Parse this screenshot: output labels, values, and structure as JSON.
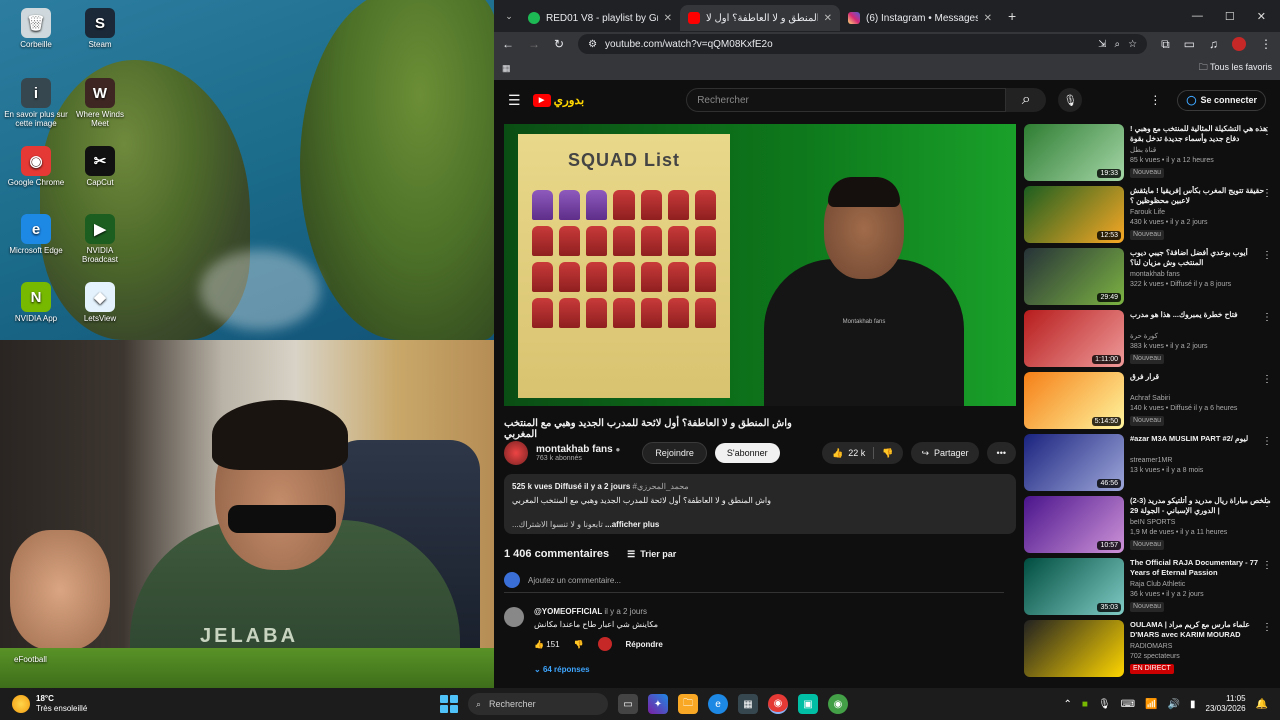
{
  "desktop": {
    "icons": [
      {
        "label": "Corbeille",
        "glyph": "🗑",
        "color": "#cfd8dc"
      },
      {
        "label": "Steam",
        "glyph": "S",
        "color": "#1b2838"
      },
      {
        "label": "En savoir plus sur cette image",
        "glyph": "i",
        "color": "#37474f"
      },
      {
        "label": "Where Winds Meet",
        "glyph": "W",
        "color": "#3e2723"
      },
      {
        "label": "Google Chrome",
        "glyph": "◉",
        "color": "#e53935"
      },
      {
        "label": "CapCut",
        "glyph": "✂",
        "color": "#111"
      },
      {
        "label": "Microsoft Edge",
        "glyph": "e",
        "color": "#1e88e5"
      },
      {
        "label": "NVIDIA Broadcast",
        "glyph": "▶",
        "color": "#1b5e20"
      },
      {
        "label": "NVIDIA App",
        "glyph": "N",
        "color": "#76b900"
      },
      {
        "label": "LetsView",
        "glyph": "◆",
        "color": "#e3f2fd"
      }
    ],
    "efootball_label": "eFootball",
    "webcam_shirt_text": "JELABA"
  },
  "browser": {
    "tabs": [
      {
        "title": "RED01 V8 - playlist by Greenbo",
        "favicon_color": "#1db954"
      },
      {
        "title": "واش المنطق و لا العاطفة؟ أول لا",
        "favicon_color": "#ff0000"
      },
      {
        "title": "(6) Instagram • Messages",
        "favicon_color": "#c13584"
      }
    ],
    "new_tab": "+",
    "url": "youtube.com/watch?v=qQM08KxfE2o",
    "bookmarks_all": "Tous les favoris"
  },
  "youtube": {
    "logo_text": "بدوري",
    "search_placeholder": "Rechercher",
    "sign_in": "Se connecter",
    "video": {
      "squad_title": "SQUAD List",
      "title": "واش المنطق و لا العاطفة؟ أول لائحة للمدرب الجديد وهبي مع المنتخب المغربي",
      "presenter_hoodie": "Montakhab fans"
    },
    "channel": {
      "name": "montakhab fans",
      "subs": "763 k abonnés",
      "join": "Rejoindre",
      "subscribe": "S'abonner",
      "likes": "22 k",
      "share": "Partager"
    },
    "description": {
      "stats": "525 k vues  Diffusé il y a 2 jours",
      "hashtag": "#محمد_المحرزي",
      "line1": "واش المنطق و لا العاطفة؟ أول لائحة للمدرب الجديد وهبي مع المنتخب المغربي",
      "line2": "...تابعونا و لا تنسوا الاشتراك",
      "more": "...afficher plus"
    },
    "comments": {
      "count": "1 406 commentaires",
      "sort": "Trier par",
      "add_placeholder": "Ajoutez un commentaire...",
      "items": [
        {
          "user": "@YOMEOFFICIAL",
          "time": "il y a 2 jours",
          "text": "مكاينش شي اعبار طاح ماعندا مكانش",
          "likes": "151",
          "reply": "Répondre"
        }
      ],
      "replies": "64 réponses"
    },
    "recommendations": [
      {
        "title": "هذه هي التشكيلة المثالية للمنتخب مع وهبي ! دفاع جديد وأسماء جديدة تدخل بقوة",
        "channel": "قناة بطل",
        "meta": "85 k vues • il y a 12 heures",
        "badge": "Nouveau",
        "duration": "19:33",
        "c1": "#2e7d32",
        "c2": "#a5d6a7"
      },
      {
        "title": "حقيقة تتويج المغرب بكأس إفريقيا ! مايثقش لاعبين محظوظين ؟",
        "channel": "Farouk Life",
        "meta": "430 k vues • il y a 2 jours",
        "badge": "Nouveau",
        "duration": "12:53",
        "c1": "#1b5e20",
        "c2": "#f9a825"
      },
      {
        "title": "أيوب بوعدي أفضل اضافة؟ جيبي ديوب المنتخب وش مزيان لنا؟",
        "channel": "montakhab fans",
        "meta": "322 k vues • Diffusé il y a 8 jours",
        "badge": "",
        "duration": "29:49",
        "c1": "#263238",
        "c2": "#7cb342"
      },
      {
        "title": "فتاح خطرة يمبروك... هذا هو مدرب",
        "channel": "كورة حرة",
        "meta": "383 k vues • il y a 2 jours",
        "badge": "Nouveau",
        "duration": "1:11:00",
        "c1": "#b71c1c",
        "c2": "#ef9a9a"
      },
      {
        "title": "قرار فرق",
        "channel": "Achraf Sabiri",
        "meta": "140 k vues • Diffusé il y a 6 heures",
        "badge": "Nouveau",
        "duration": "5:14:50",
        "c1": "#f57f17",
        "c2": "#fff59d"
      },
      {
        "title": "#azar  M3A MUSLIM PART #2/ ليوم",
        "channel": "streamer1MR",
        "meta": "13 k vues • il y a 8 mois",
        "badge": "",
        "duration": "46:56",
        "c1": "#1a237e",
        "c2": "#9fa8da"
      },
      {
        "title": "ملخص مباراة ريال مدريد و أتلتيكو مدريد (3-2) | الدوري الإسباني - الجولة 29",
        "channel": "beIN SPORTS",
        "meta": "1,9 M de vues • il y a 11 heures",
        "badge": "Nouveau",
        "duration": "10:57",
        "c1": "#4a148c",
        "c2": "#ce93d8"
      },
      {
        "title": "The Official RAJA Documentary - 77 Years of Eternal Passion",
        "channel": "Raja Club Athletic",
        "meta": "36 k vues • il y a 2 jours",
        "badge": "Nouveau",
        "duration": "35:03",
        "c1": "#004d40",
        "c2": "#80cbc4"
      },
      {
        "title": "OULAMA | علماء مارس مع كريم مراد D'MARS avec KARIM MOURAD",
        "channel": "RADIOMARS",
        "meta": "702 spectateurs",
        "badge": "EN DIRECT",
        "duration": "",
        "c1": "#212121",
        "c2": "#ffd600"
      }
    ]
  },
  "taskbar": {
    "temp": "18°C",
    "weather": "Très ensoleillé",
    "search": "Rechercher",
    "time": "11:05",
    "date": "23/03/2026"
  }
}
